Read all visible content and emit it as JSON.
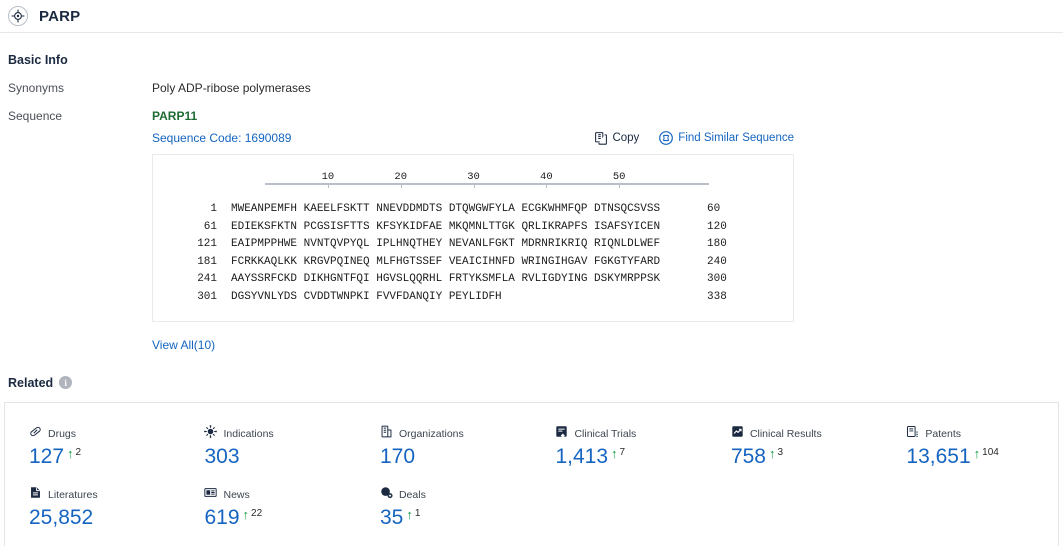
{
  "header": {
    "icon": "target-icon",
    "title": "PARP"
  },
  "basic_info": {
    "section_title": "Basic Info",
    "synonyms_label": "Synonyms",
    "synonyms_value": "Poly ADP-ribose polymerases",
    "sequence_label": "Sequence",
    "gene_name": "PARP11",
    "sequence_code": "Sequence Code: 1690089",
    "copy_label": "Copy",
    "copy_icon": "copy-icon",
    "find_similar_label": "Find Similar Sequence",
    "find_similar_icon": "find-similar-sequence-icon",
    "view_all_label": "View All(10)"
  },
  "sequence_viewer": {
    "ruler_ticks": [
      10,
      20,
      30,
      40,
      50
    ],
    "rows": [
      {
        "start": "1",
        "chunks": "MWEANPEMFH KAEELFSKTT NNEVDDMDTS DTQWGWFYLA ECGKWHMFQP DTNSQCSVSS",
        "end": "60"
      },
      {
        "start": "61",
        "chunks": "EDIEKSFKTN PCGSISFTTS KFSYKIDFAE MKQMNLTTGK QRLIKRAPFS ISAFSYICEN",
        "end": "120"
      },
      {
        "start": "121",
        "chunks": "EAIPMPPHWE NVNTQVPYQL IPLHNQTHEY NEVANLFGKT MDRNRIKRIQ RIQNLDLWEF",
        "end": "180"
      },
      {
        "start": "181",
        "chunks": "FCRKKAQLKK KRGVPQINEQ MLFHGTSSEF VEAICIHNFD WRINGIHGAV FGKGTYFARD",
        "end": "240"
      },
      {
        "start": "241",
        "chunks": "AAYSSRFCKD DIKHGNTFQI HGVSLQQRHL FRTYKSMFLA RVLIGDYING DSKYMRPPSK",
        "end": "300"
      },
      {
        "start": "301",
        "chunks": "DGSYVNLYDS CVDDTWNPKI FVVFDANQIY PEYLIDFH",
        "end": "338"
      }
    ]
  },
  "related": {
    "title": "Related",
    "info_icon": "info-icon",
    "info_glyph": "i",
    "stats": [
      {
        "label": "Drugs",
        "icon": "pill-icon",
        "value": "127",
        "delta": "2",
        "has_delta": true,
        "arrow": "↑"
      },
      {
        "label": "Indications",
        "icon": "virus-icon",
        "value": "303",
        "delta": "",
        "has_delta": false,
        "arrow": "↑"
      },
      {
        "label": "Organizations",
        "icon": "building-icon",
        "value": "170",
        "delta": "",
        "has_delta": false,
        "arrow": "↑"
      },
      {
        "label": "Clinical Trials",
        "icon": "clipboard-icon",
        "value": "1,413",
        "delta": "7",
        "has_delta": true,
        "arrow": "↑"
      },
      {
        "label": "Clinical Results",
        "icon": "clinical-results-icon",
        "value": "758",
        "delta": "3",
        "has_delta": true,
        "arrow": "↑"
      },
      {
        "label": "Patents",
        "icon": "patent-icon",
        "value": "13,651",
        "delta": "104",
        "has_delta": true,
        "arrow": "↑"
      },
      {
        "label": "Literatures",
        "icon": "document-icon",
        "value": "25,852",
        "delta": "",
        "has_delta": false,
        "arrow": "↑"
      },
      {
        "label": "News",
        "icon": "news-icon",
        "value": "619",
        "delta": "22",
        "has_delta": true,
        "arrow": "↑"
      },
      {
        "label": "Deals",
        "icon": "deals-icon",
        "value": "35",
        "delta": "1",
        "has_delta": true,
        "arrow": "↑"
      }
    ]
  },
  "colors": {
    "accent_blue": "#1565c0",
    "gene_green": "#1f6b34",
    "delta_green": "#0f9d45",
    "dark_navy": "#1b2a41",
    "border": "#e1e4e8"
  }
}
